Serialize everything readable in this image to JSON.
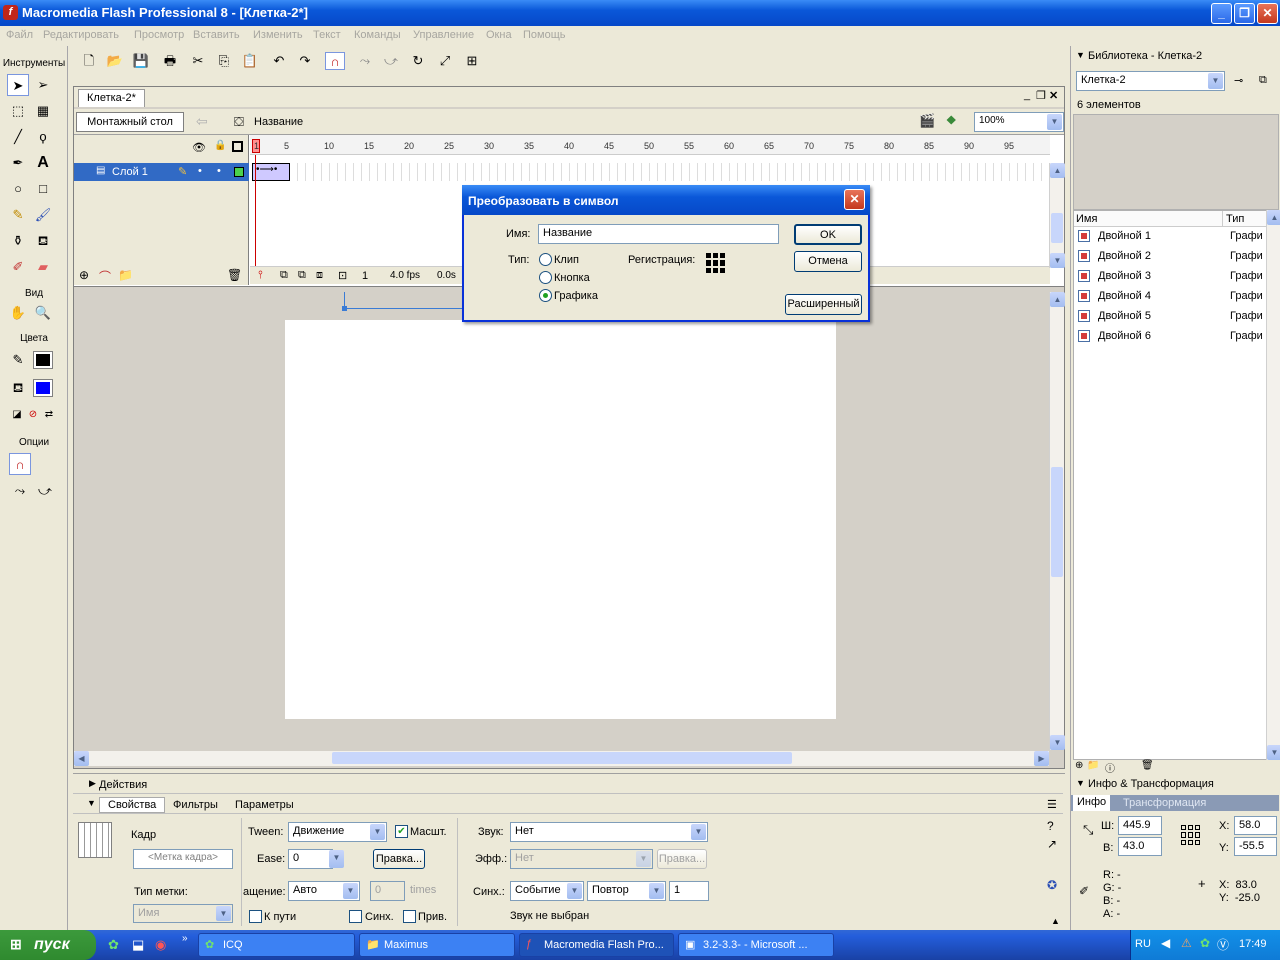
{
  "window": {
    "title": "Macromedia Flash Professional 8 - [Клетка-2*]",
    "min": "_",
    "max": "❐",
    "close": "✕"
  },
  "menu": [
    "Файл",
    "Редактировать",
    "Просмотр",
    "Вставить",
    "Изменить",
    "Текст",
    "Команды",
    "Управление",
    "Окна",
    "Помощь"
  ],
  "toolbox": {
    "tools_label": "Инструменты",
    "view_label": "Вид",
    "colors_label": "Цвета",
    "options_label": "Опции"
  },
  "document": {
    "tab": "Клетка-2*",
    "scene_button": "Монтажный стол",
    "symbol_name": "Название",
    "zoom": "100%",
    "layer_name": "Слой 1",
    "frame_ticks": [
      "1",
      "5",
      "10",
      "15",
      "20",
      "25",
      "30",
      "35",
      "40",
      "45",
      "50",
      "55",
      "60",
      "65",
      "70",
      "75",
      "80",
      "85",
      "90",
      "95"
    ],
    "current_frame": "1",
    "fps": "4.0 fps",
    "time": "0.0s"
  },
  "dialog": {
    "title": "Преобразовать в символ",
    "name_label": "Имя:",
    "name_value": "Название",
    "type_label": "Тип:",
    "types": [
      "Клип",
      "Кнопка",
      "Графика"
    ],
    "selected_type": "Графика",
    "registration_label": "Регистрация:",
    "ok": "OK",
    "cancel": "Отмена",
    "advanced": "Расширенный",
    "close": "✕"
  },
  "library": {
    "header": "Библиотека - Клетка-2",
    "selector": "Клетка-2",
    "count": "6 элементов",
    "col_name": "Имя",
    "col_type": "Тип",
    "items": [
      {
        "name": "Двойной 1",
        "type": "Графи"
      },
      {
        "name": "Двойной 2",
        "type": "Графи"
      },
      {
        "name": "Двойной 3",
        "type": "Графи"
      },
      {
        "name": "Двойной 4",
        "type": "Графи"
      },
      {
        "name": "Двойной 5",
        "type": "Графи"
      },
      {
        "name": "Двойной 6",
        "type": "Графи"
      }
    ]
  },
  "properties": {
    "actions_header": "Действия",
    "tabs": [
      "Свойства",
      "Фильтры",
      "Параметры"
    ],
    "frame_label": "Кадр",
    "frame_label_placeholder": "<Метка кадра>",
    "label_type_label": "Тип метки:",
    "label_type_value": "Имя",
    "tween_label": "Tween:",
    "tween_value": "Движение",
    "scale_label": "Масшт.",
    "ease_label": "Ease:",
    "ease_value": "0",
    "edit_button": "Правка...",
    "rotate_label": "ащение:",
    "rotate_value": "Авто",
    "times_value": "0",
    "times_label": "times",
    "path_label": "К пути",
    "sync_label": "Синх.",
    "snap_label": "Прив.",
    "sound_label": "Звук:",
    "sound_value": "Нет",
    "effect_label": "Эфф.:",
    "effect_value": "Нет",
    "effect_edit": "Правка...",
    "sync2_label": "Синх.:",
    "sync2_value": "Событие",
    "repeat_value": "Повтор",
    "repeat_count": "1",
    "no_sound": "Звук не выбран"
  },
  "info": {
    "header": "Инфо & Трансформация",
    "tab_info": "Инфо",
    "tab_transform": "Трансформация",
    "w_label": "Ш:",
    "w_value": "445.9",
    "h_label": "В:",
    "h_value": "43.0",
    "x_label": "X:",
    "x_value": "58.0",
    "y_label": "Y:",
    "y_value": "-55.5",
    "r": "R: -",
    "g": "G: -",
    "b": "B: -",
    "a": "A: -",
    "mx": "X:  83.0",
    "my": "Y:  -25.0"
  },
  "taskbar": {
    "start": "пуск",
    "tasks": [
      "ICQ",
      "Maximus",
      "Macromedia Flash Pro...",
      "3.2-3.3- - Microsoft ..."
    ],
    "lang": "RU",
    "clock": "17:49"
  }
}
